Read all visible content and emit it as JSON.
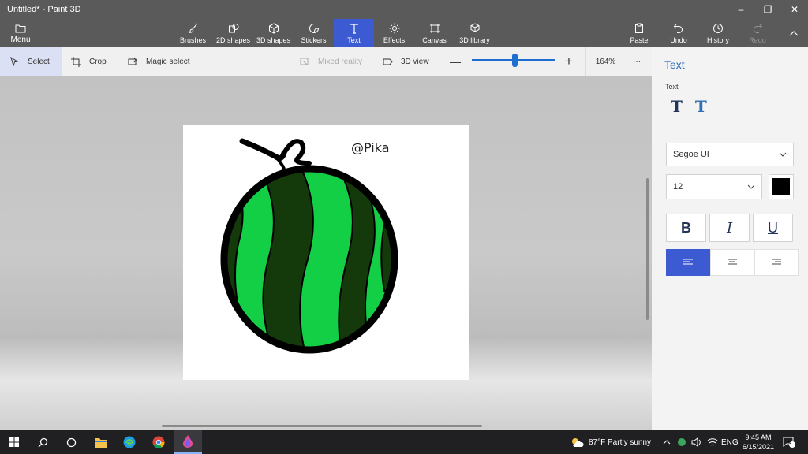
{
  "window": {
    "title": "Untitled* - Paint 3D",
    "minimize": "–",
    "restore": "❐",
    "close": "✕"
  },
  "ribbon": {
    "menu": "Menu",
    "tools": [
      {
        "label": "Brushes",
        "icon": "brush-icon"
      },
      {
        "label": "2D shapes",
        "icon": "shapes-2d-icon"
      },
      {
        "label": "3D shapes",
        "icon": "cube-icon"
      },
      {
        "label": "Stickers",
        "icon": "sticker-icon"
      },
      {
        "label": "Text",
        "icon": "text-icon"
      },
      {
        "label": "Effects",
        "icon": "sun-icon"
      },
      {
        "label": "Canvas",
        "icon": "canvas-icon"
      },
      {
        "label": "3D library",
        "icon": "library-icon"
      }
    ],
    "active_tool": "Text",
    "actions": [
      {
        "label": "Paste",
        "icon": "paste-icon"
      },
      {
        "label": "Undo",
        "icon": "undo-icon"
      },
      {
        "label": "History",
        "icon": "history-icon"
      },
      {
        "label": "Redo",
        "icon": "redo-icon"
      }
    ]
  },
  "subbar": {
    "select": "Select",
    "crop": "Crop",
    "magic_select": "Magic select",
    "mixed_reality": "Mixed reality",
    "view_3d": "3D view",
    "zoom": "164%",
    "zoom_level": 0.5,
    "more": "···"
  },
  "canvas": {
    "text": "@Pika"
  },
  "panel": {
    "title": "Text",
    "subtitle": "Text",
    "font": "Segoe UI",
    "size": "12",
    "text_color": "#000000",
    "bold": "B",
    "italic": "I",
    "underline": "U",
    "align_active": "left"
  },
  "taskbar": {
    "weather": "87°F  Partly sunny",
    "lang": "ENG",
    "time": "9:45 AM",
    "date": "6/15/2021",
    "notifications": "3"
  },
  "colors": {
    "ribbon": "#5a5a5a",
    "accent": "#3c5ad2",
    "melon_dark": "#143a0c",
    "melon_light": "#12cf45"
  }
}
